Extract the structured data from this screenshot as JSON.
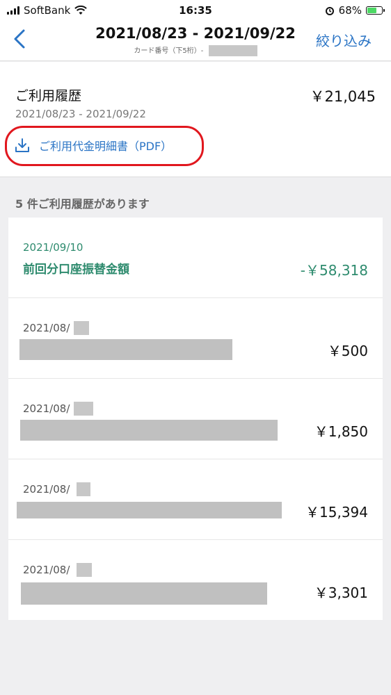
{
  "status_bar": {
    "carrier": "SoftBank",
    "time": "16:35",
    "battery_percent": "68%",
    "battery_level": 0.68
  },
  "nav": {
    "title": "2021/08/23 - 2021/09/22",
    "subtitle": "カード番号（下5桁）-",
    "filter_label": "絞り込み"
  },
  "summary": {
    "label": "ご利用履歴",
    "total": "￥21,045",
    "range": "2021/08/23 - 2021/09/22",
    "pdf_link": "ご利用代金明細書（PDF）"
  },
  "list_header": "5 件ご利用履歴があります",
  "transactions": [
    {
      "date": "2021/09/10",
      "name": "前回分口座振替金額",
      "amount": "-￥58,318"
    },
    {
      "date": "2021/08/",
      "amount": "￥500"
    },
    {
      "date": "2021/08/",
      "amount": "￥1,850"
    },
    {
      "date": "2021/08/",
      "amount": "￥15,394"
    },
    {
      "date": "2021/08/",
      "amount": "￥3,301"
    }
  ]
}
